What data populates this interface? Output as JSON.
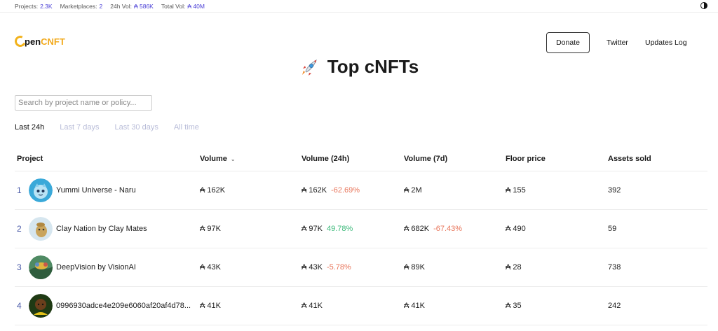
{
  "stats": [
    {
      "label": "Projects:",
      "value": "2.3K"
    },
    {
      "label": "Marketplaces:",
      "value": "2"
    },
    {
      "label": "24h Vol:",
      "value": "₳ 586K"
    },
    {
      "label": "Total Vol:",
      "value": "₳ 40M"
    }
  ],
  "brand": {
    "logo_text": "pen",
    "logo_accent": "CNFT",
    "ring_color": "#f2b21b"
  },
  "nav": {
    "donate": "Donate",
    "twitter": "Twitter",
    "updates": "Updates Log"
  },
  "page": {
    "title": "Top cNFTs",
    "icon": "rocket-icon"
  },
  "search": {
    "placeholder": "Search by project name or policy..."
  },
  "time_tabs": [
    "Last 24h",
    "Last 7 days",
    "Last 30 days",
    "All time"
  ],
  "table": {
    "headers": {
      "project": "Project",
      "volume": "Volume",
      "volume24": "Volume (24h)",
      "volume7": "Volume (7d)",
      "floor": "Floor price",
      "sold": "Assets sold"
    },
    "rows": [
      {
        "rank": "1",
        "name": "Yummi Universe - Naru",
        "volume": "₳ 162K",
        "volume24": "₳ 162K",
        "change24": "-62.69%",
        "volume7": "₳ 2M",
        "change7": "",
        "floor": "₳ 155",
        "sold": "392"
      },
      {
        "rank": "2",
        "name": "Clay Nation by Clay Mates",
        "volume": "₳ 97K",
        "volume24": "₳ 97K",
        "change24": "49.78%",
        "volume7": "₳ 682K",
        "change7": "-67.43%",
        "floor": "₳ 490",
        "sold": "59"
      },
      {
        "rank": "3",
        "name": "DeepVision by VisionAI",
        "volume": "₳ 43K",
        "volume24": "₳ 43K",
        "change24": "-5.78%",
        "volume7": "₳ 89K",
        "change7": "",
        "floor": "₳ 28",
        "sold": "738"
      },
      {
        "rank": "4",
        "name": "0996930adce4e209e6060af20af4d78...",
        "volume": "₳ 41K",
        "volume24": "₳ 41K",
        "change24": "",
        "volume7": "₳ 41K",
        "change7": "",
        "floor": "₳ 35",
        "sold": "242"
      }
    ]
  },
  "colors": {
    "accent": "#4a3fd6",
    "negative": "#e8755a",
    "positive": "#3cb97a"
  }
}
